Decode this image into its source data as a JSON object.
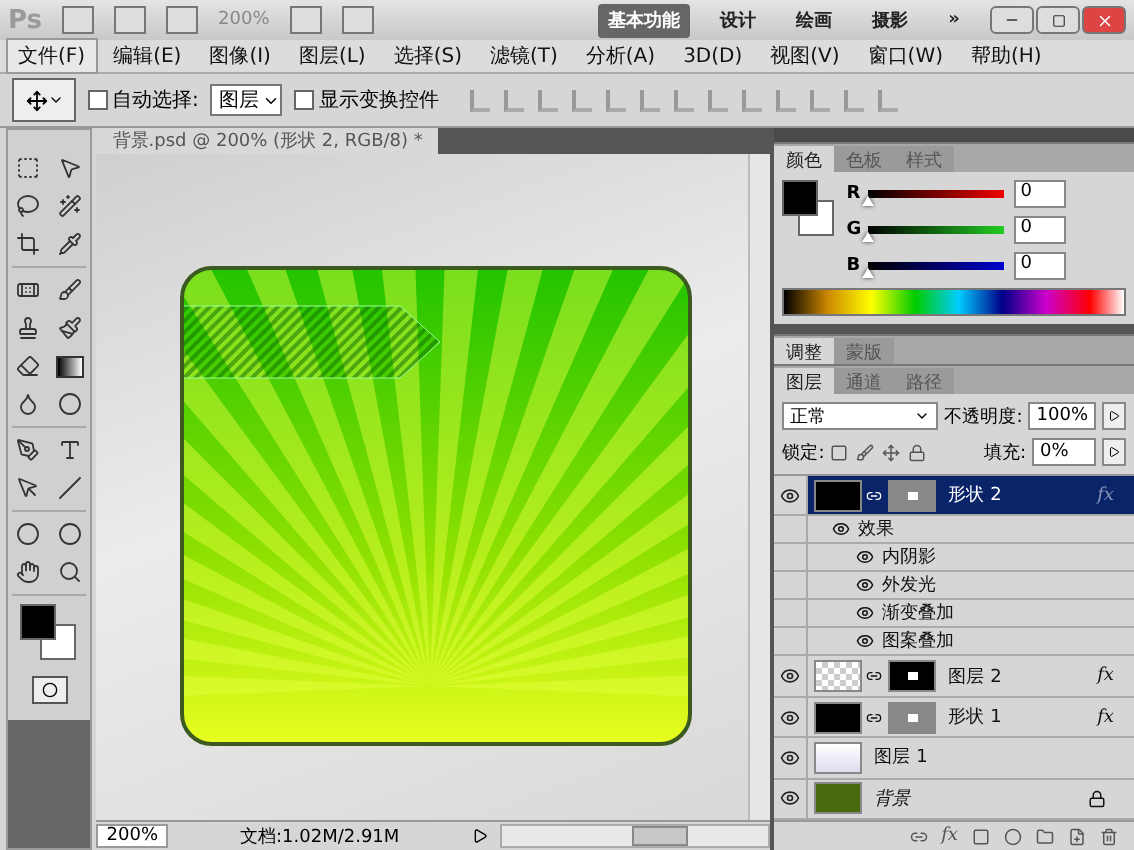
{
  "app_bar": {
    "logo": "Ps",
    "zoom": "200%",
    "workspaces": [
      {
        "label": "基本功能",
        "selected": true
      },
      {
        "label": "设计",
        "selected": false
      },
      {
        "label": "绘画",
        "selected": false
      },
      {
        "label": "摄影",
        "selected": false
      }
    ],
    "overflow": "»"
  },
  "menu": [
    {
      "label": "文件(F)",
      "selected": true
    },
    {
      "label": "编辑(E)",
      "selected": false
    },
    {
      "label": "图像(I)",
      "selected": false
    },
    {
      "label": "图层(L)",
      "selected": false
    },
    {
      "label": "选择(S)",
      "selected": false
    },
    {
      "label": "滤镜(T)",
      "selected": false
    },
    {
      "label": "分析(A)",
      "selected": false
    },
    {
      "label": "3D(D)",
      "selected": false
    },
    {
      "label": "视图(V)",
      "selected": false
    },
    {
      "label": "窗口(W)",
      "selected": false
    },
    {
      "label": "帮助(H)",
      "selected": false
    }
  ],
  "options": {
    "auto_select": {
      "label": "自动选择:",
      "checked": false
    },
    "target": "图层",
    "show_transform": {
      "label": "显示变换控件",
      "checked": false
    }
  },
  "document": {
    "tab": "背景.psd @ 200% (形状 2, RGB/8) *",
    "zoom": "200%",
    "info": "文档:1.02M/2.91M"
  },
  "color_panel": {
    "tabs": [
      {
        "label": "颜色",
        "selected": true
      },
      {
        "label": "色板",
        "selected": false
      },
      {
        "label": "样式",
        "selected": false
      }
    ],
    "channels": [
      {
        "label": "R",
        "value": "0",
        "level": 0
      },
      {
        "label": "G",
        "value": "0",
        "level": 0
      },
      {
        "label": "B",
        "value": "0",
        "level": 0
      }
    ]
  },
  "adjust_panel": {
    "tabs": [
      {
        "label": "调整",
        "selected": true
      },
      {
        "label": "蒙版",
        "selected": false
      }
    ]
  },
  "layers_panel": {
    "tabs": [
      {
        "label": "图层",
        "selected": true
      },
      {
        "label": "通道",
        "selected": false
      },
      {
        "label": "路径",
        "selected": false
      }
    ],
    "fx_button": "fx",
    "blend_mode": "正常",
    "opacity_label": "不透明度:",
    "opacity": "100%",
    "lock_label": "锁定:",
    "fill_label": "填充:",
    "fill": "0%",
    "layers": [
      {
        "name": "形状 2",
        "selected": true,
        "visible": true,
        "thumb": {
          "kind": "black"
        },
        "mask": {
          "kind": "grey"
        },
        "fx": "fx",
        "locked": false,
        "effects": {
          "label": "效果",
          "visible": true,
          "children": [
            {
              "label": "内阴影",
              "visible": true
            },
            {
              "label": "外发光",
              "visible": true
            },
            {
              "label": "渐变叠加",
              "visible": true
            },
            {
              "label": "图案叠加",
              "visible": true
            }
          ]
        }
      },
      {
        "name": "图层 2",
        "selected": false,
        "visible": true,
        "thumb": {
          "kind": "checker"
        },
        "mask": {
          "kind": "black"
        },
        "fx": "fx",
        "locked": false
      },
      {
        "name": "形状 1",
        "selected": false,
        "visible": true,
        "thumb": {
          "kind": "black"
        },
        "mask": {
          "kind": "grey"
        },
        "fx": "fx",
        "locked": false
      },
      {
        "name": "图层 1",
        "selected": false,
        "visible": true,
        "thumb": {
          "kind": "light"
        },
        "locked": false
      },
      {
        "name": "背景",
        "selected": false,
        "visible": true,
        "thumb": {
          "kind": "green"
        },
        "locked": true
      }
    ]
  }
}
